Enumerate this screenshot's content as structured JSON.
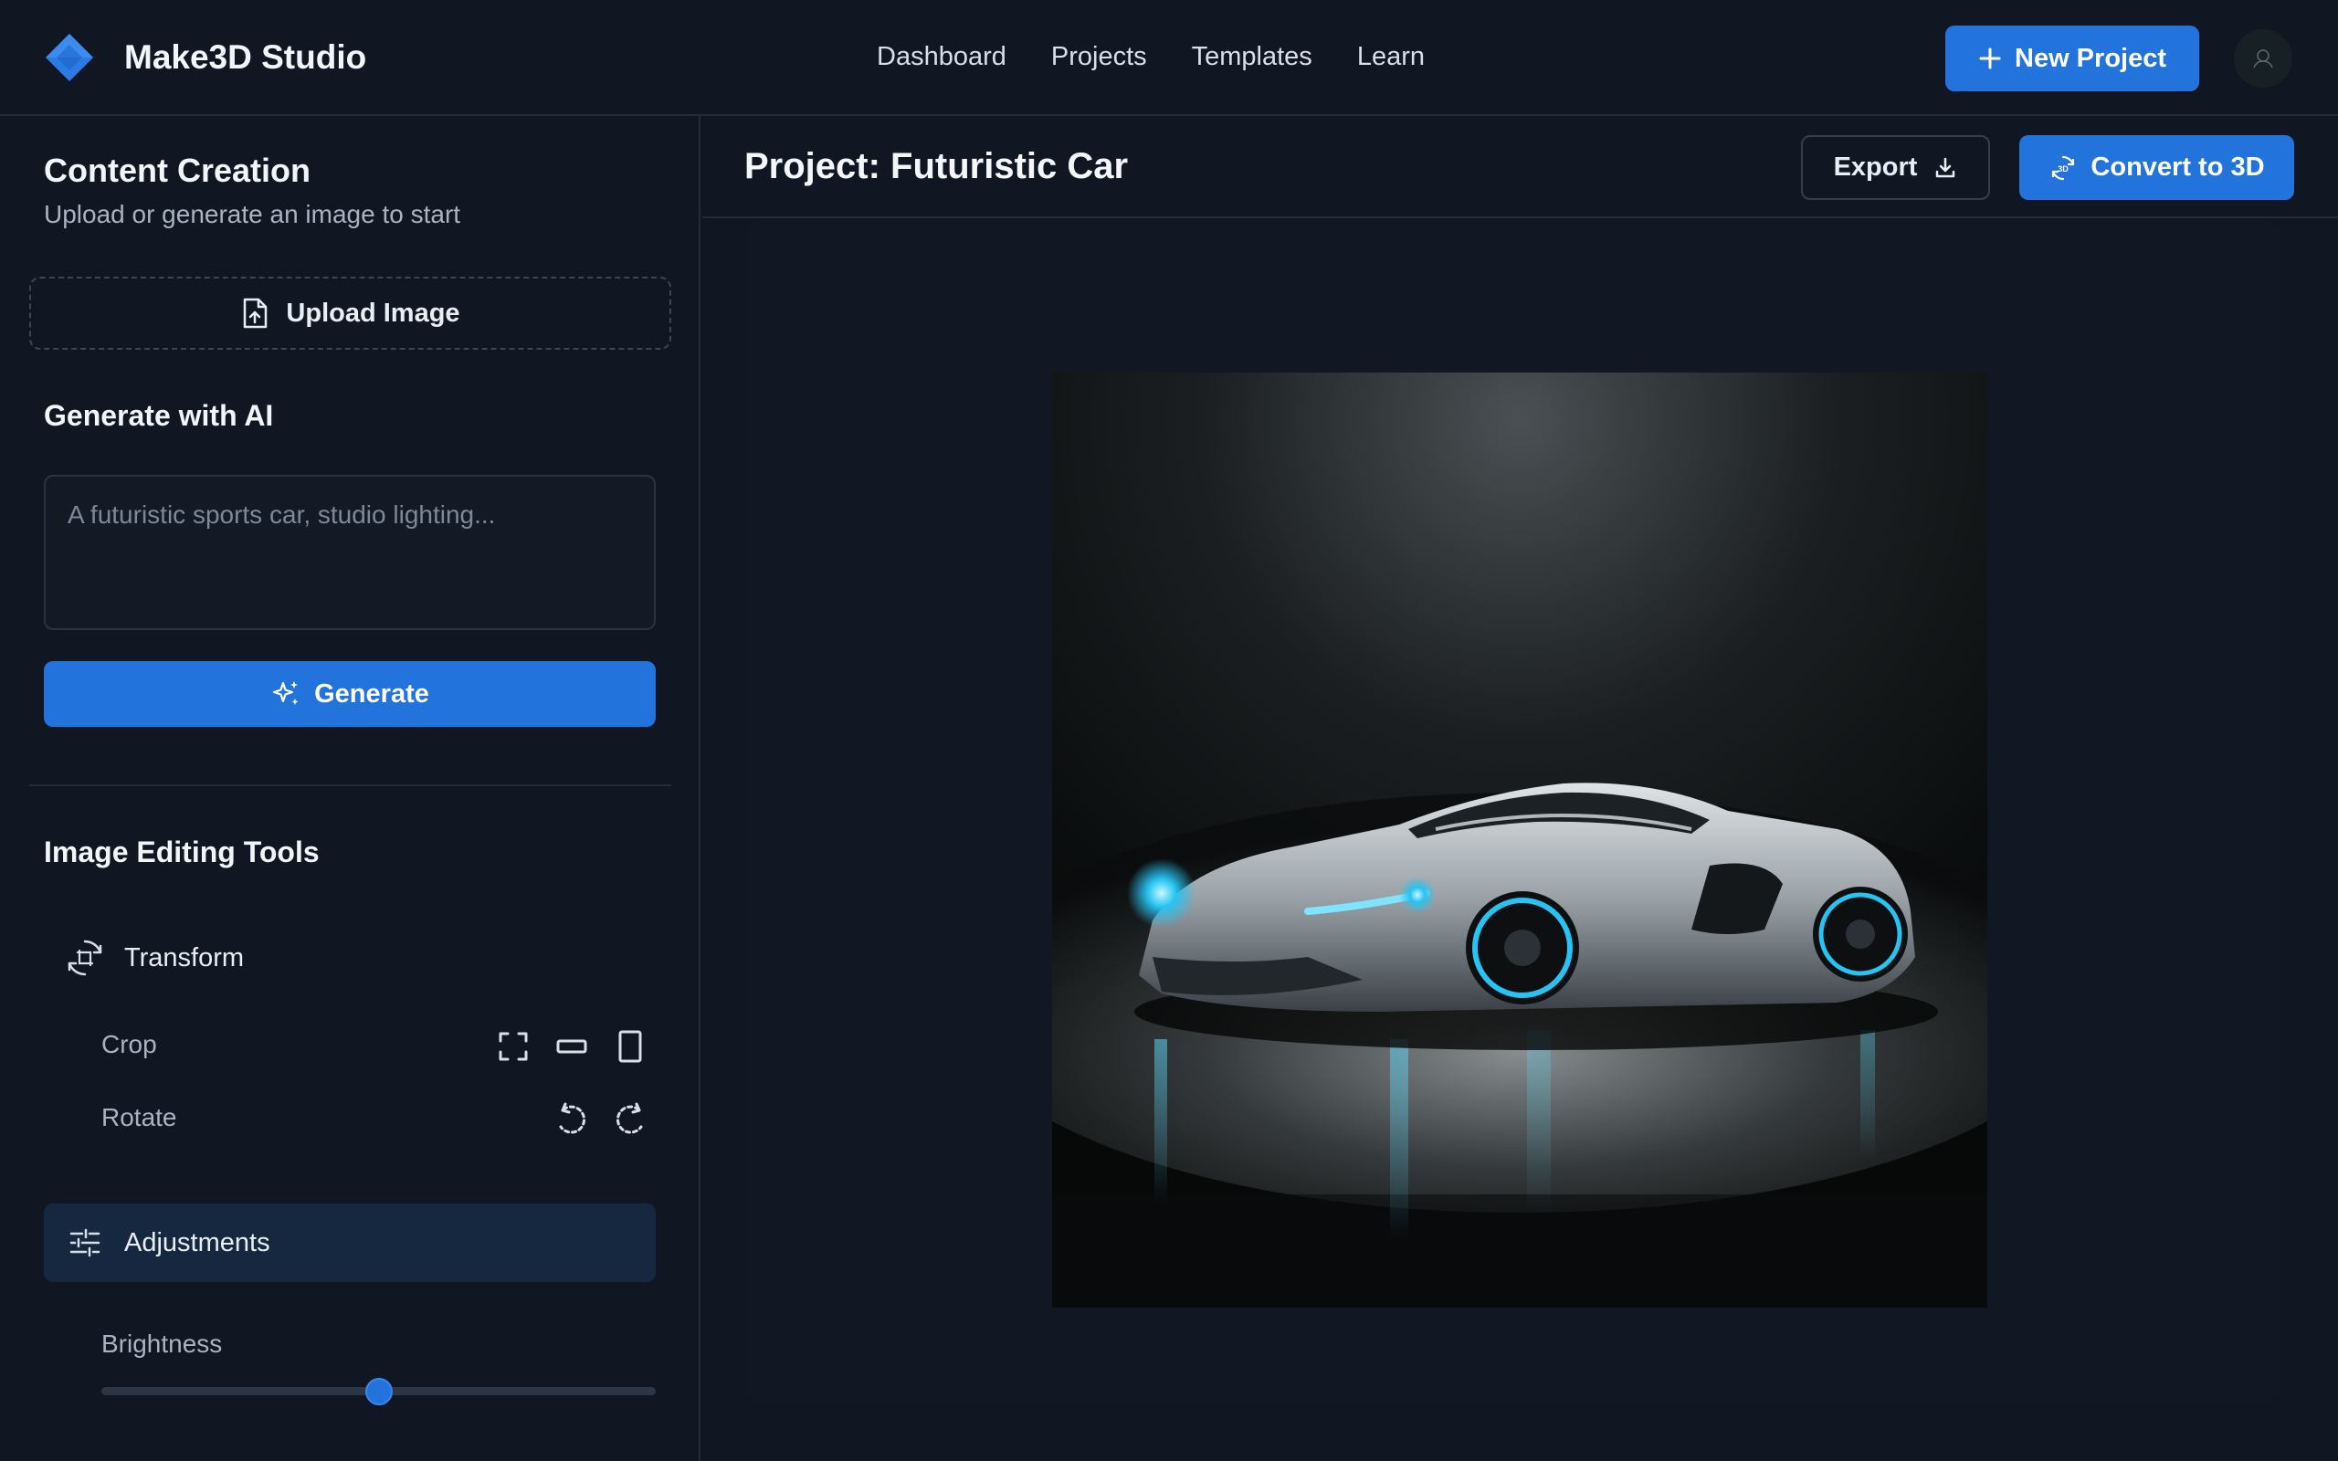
{
  "header": {
    "brand": "Make3D Studio",
    "logo_icon": "diamond-logo-icon",
    "nav": [
      "Dashboard",
      "Projects",
      "Templates",
      "Learn"
    ],
    "new_project_label": "New Project",
    "accent_color": "#2273dc"
  },
  "sidebar": {
    "title": "Content Creation",
    "subtitle": "Upload or generate an image to start",
    "upload_label": "Upload Image",
    "generate_section_title": "Generate with AI",
    "prompt_placeholder": "A futuristic sports car, studio lighting...",
    "prompt_value": "",
    "generate_label": "Generate",
    "editing_title": "Image Editing Tools",
    "transform_label": "Transform",
    "crop_label": "Crop",
    "rotate_label": "Rotate",
    "adjustments_label": "Adjustments",
    "brightness_label": "Brightness",
    "brightness_value": 0.5
  },
  "main": {
    "project_title": "Project: Futuristic Car",
    "export_label": "Export",
    "convert_label": "Convert to 3D"
  }
}
